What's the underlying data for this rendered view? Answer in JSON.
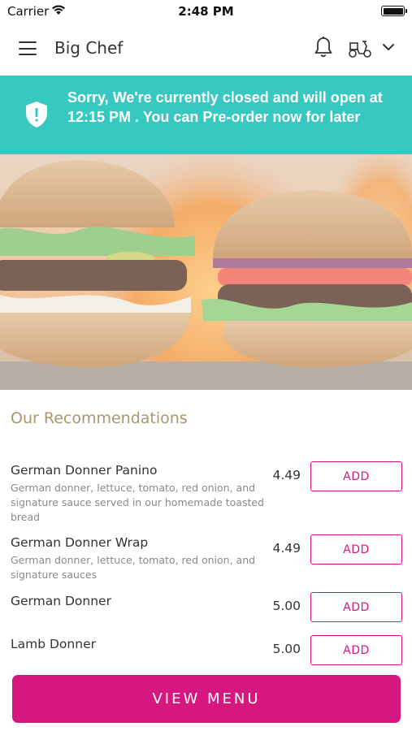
{
  "status_bar": {
    "carrier": "Carrier",
    "time": "2:48 PM"
  },
  "header": {
    "title": "Big Chef",
    "icons": [
      "menu-icon",
      "bell-icon",
      "scooter-icon",
      "chevron-down-icon"
    ]
  },
  "banner": {
    "message": "Sorry, We're currently closed and will open at 12:15 PM . You can Pre-order now for later",
    "icon": "shield-alert-icon",
    "background_color": "#37c8c1"
  },
  "hero": {
    "image": "burgers-flames-photo"
  },
  "recommendations": {
    "title": "Our Recommendations",
    "items": [
      {
        "name": "German Donner Panino",
        "description": "German donner, lettuce, tomato, red onion, and signature sauce served in our homemade toasted bread",
        "price": "4.49",
        "action_label": "ADD"
      },
      {
        "name": "German Donner Wrap",
        "description": "German donner, lettuce, tomato, red onion, and signature sauces",
        "price": "4.49",
        "action_label": "ADD"
      },
      {
        "name": "German Donner",
        "description": "",
        "price": "5.00",
        "action_label": "ADD"
      },
      {
        "name": "Lamb Donner",
        "description": "",
        "price": "5.00",
        "action_label": "ADD"
      }
    ]
  },
  "footer": {
    "view_menu_label": "VIEW MENU"
  },
  "colors": {
    "accent": "#d6177f",
    "section_title": "#a8986f",
    "banner": "#37c8c1"
  }
}
